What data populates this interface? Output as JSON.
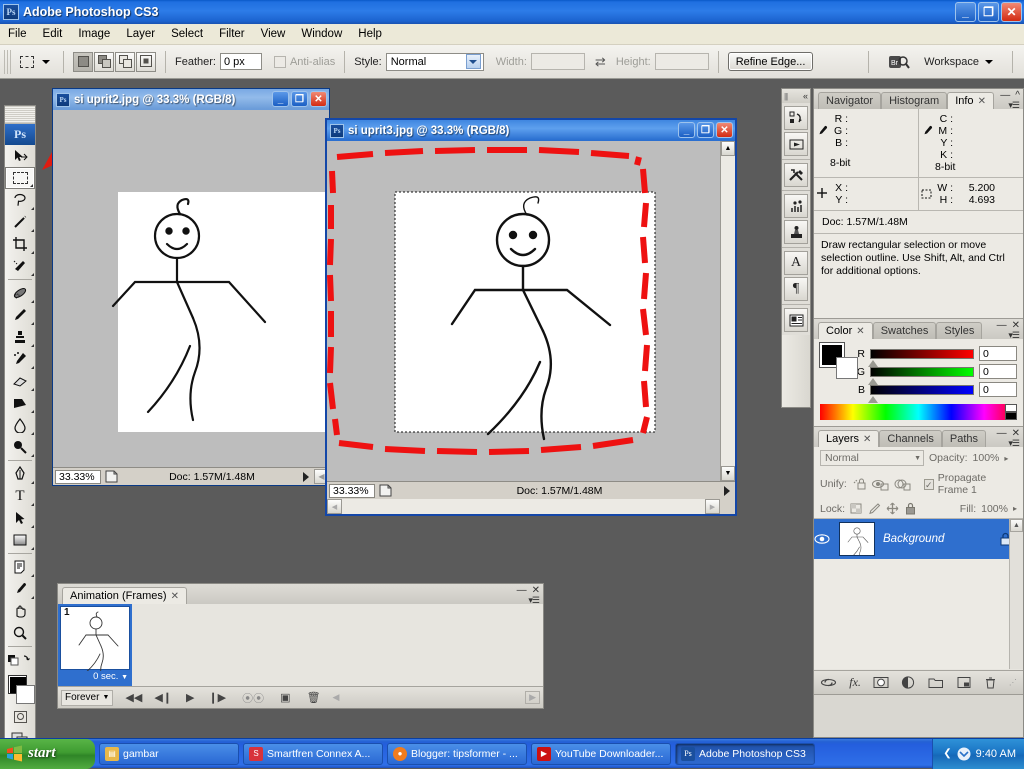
{
  "app": {
    "title": "Adobe Photoshop CS3",
    "icon": "photoshop-icon",
    "min_label": "_",
    "max_label": "□",
    "close_label": "✕"
  },
  "menubar": {
    "items": [
      "File",
      "Edit",
      "Image",
      "Layer",
      "Select",
      "Filter",
      "View",
      "Window",
      "Help"
    ]
  },
  "options_bar": {
    "tool_icon": "rectangular-marquee-icon",
    "feather_label": "Feather:",
    "feather_value": "0 px",
    "antialias_label": "Anti-alias",
    "style_label": "Style:",
    "style_value": "Normal",
    "width_label": "Width:",
    "width_value": "",
    "height_label": "Height:",
    "height_value": "",
    "swap_icon": "swap-dimensions-icon",
    "refine_edge_label": "Refine Edge...",
    "bridge_icon": "go-to-bridge-icon",
    "workspace_label": "Workspace"
  },
  "toolbox": {
    "tools": [
      {
        "name": "move-tool",
        "glyph": "↖",
        "selected": false
      },
      {
        "name": "rectangular-marquee-tool",
        "glyph": "⬚",
        "selected": true
      },
      {
        "name": "lasso-tool",
        "glyph": "☂",
        "selected": false
      },
      {
        "name": "magic-wand-tool",
        "glyph": "✦",
        "selected": false
      },
      {
        "name": "crop-tool",
        "glyph": "⛶",
        "selected": false
      },
      {
        "name": "slice-tool",
        "glyph": "✂",
        "selected": false
      },
      {
        "name": "healing-brush-tool",
        "glyph": "✎",
        "selected": false
      },
      {
        "name": "brush-tool",
        "glyph": "✐",
        "selected": false
      },
      {
        "name": "clone-stamp-tool",
        "glyph": "⚘",
        "selected": false
      },
      {
        "name": "history-brush-tool",
        "glyph": "✒",
        "selected": false
      },
      {
        "name": "eraser-tool",
        "glyph": "▱",
        "selected": false
      },
      {
        "name": "gradient-tool",
        "glyph": "◢",
        "selected": false
      },
      {
        "name": "blur-tool",
        "glyph": "◌",
        "selected": false
      },
      {
        "name": "dodge-tool",
        "glyph": "⚲",
        "selected": false
      },
      {
        "name": "pen-tool",
        "glyph": "✑",
        "selected": false
      },
      {
        "name": "horizontal-type-tool",
        "glyph": "T",
        "selected": false
      },
      {
        "name": "path-selection-tool",
        "glyph": "➤",
        "selected": false
      },
      {
        "name": "rectangle-shape-tool",
        "glyph": "▣",
        "selected": false
      },
      {
        "name": "notes-tool",
        "glyph": "▤",
        "selected": false
      },
      {
        "name": "eyedropper-tool",
        "glyph": "⚗",
        "selected": false
      },
      {
        "name": "hand-tool",
        "glyph": "✋",
        "selected": false
      },
      {
        "name": "zoom-tool",
        "glyph": "⚲",
        "selected": false
      }
    ],
    "foreground_color": "#000000",
    "background_color": "#ffffff",
    "quickmask_icon": "quick-mask-icon",
    "screenmode_icon": "screen-mode-icon"
  },
  "documents": [
    {
      "name": "doc-window-uprit2",
      "title": "si uprit2.jpg @ 33.3% (RGB/8)",
      "zoom": "33.33%",
      "doc_info": "Doc: 1.57M/1.48M",
      "active": false
    },
    {
      "name": "doc-window-uprit3",
      "title": "si uprit3.jpg @ 33.3% (RGB/8)",
      "zoom": "33.33%",
      "doc_info": "Doc: 1.57M/1.48M",
      "active": true
    }
  ],
  "animation_panel": {
    "tab_label": "Animation (Frames)",
    "frames": [
      {
        "number": "1",
        "delay": "0 sec."
      }
    ],
    "loop_label": "Forever",
    "buttons": [
      "select-first-frame",
      "select-previous-frame",
      "play-animation",
      "select-next-frame",
      "tween-frames",
      "duplicate-frame",
      "delete-frame"
    ]
  },
  "icon_strip": {
    "collapse_label": "«",
    "icons": [
      "history-actions-icon",
      "animation-icon",
      "tool-presets-icon",
      "brushes-icon",
      "clone-source-icon",
      "character-icon",
      "paragraph-icon",
      "layer-comps-icon"
    ]
  },
  "info_panel": {
    "tabs": [
      "Navigator",
      "Histogram",
      "Info"
    ],
    "active_tab": "Info",
    "left": {
      "labels": [
        "R :",
        "G :",
        "B :"
      ],
      "values": [
        "",
        "",
        ""
      ],
      "bits": "8-bit"
    },
    "right": {
      "labels": [
        "C :",
        "M :",
        "Y :",
        "K :"
      ],
      "values": [
        "",
        "",
        "",
        ""
      ],
      "bits": "8-bit"
    },
    "pos_labels": [
      "X :",
      "Y :"
    ],
    "pos_values": [
      "",
      ""
    ],
    "size_labels": [
      "W :",
      "H :"
    ],
    "size_values": [
      "5.200",
      "4.693"
    ],
    "doc_line": "Doc: 1.57M/1.48M",
    "hint": "Draw rectangular selection or move selection outline.  Use Shift, Alt, and Ctrl for additional options."
  },
  "color_panel": {
    "tabs": [
      "Color",
      "Swatches",
      "Styles"
    ],
    "active_tab": "Color",
    "channels": [
      {
        "label": "R",
        "value": "0",
        "from": "#000000",
        "to": "#ff0000"
      },
      {
        "label": "G",
        "value": "0",
        "from": "#000000",
        "to": "#00ff00"
      },
      {
        "label": "B",
        "value": "0",
        "from": "#000000",
        "to": "#0000ff"
      }
    ],
    "foreground": "#000000",
    "background": "#ffffff"
  },
  "layers_panel": {
    "tabs": [
      "Layers",
      "Channels",
      "Paths"
    ],
    "active_tab": "Layers",
    "blend_mode": "Normal",
    "opacity_label": "Opacity:",
    "opacity_value": "100%",
    "unify_label": "Unify:",
    "propagate_label": "Propagate Frame 1",
    "lock_label": "Lock:",
    "fill_label": "Fill:",
    "fill_value": "100%",
    "layers": [
      {
        "name": "Background",
        "visible": true,
        "locked": true,
        "selected": true
      }
    ],
    "bottom_buttons": [
      "link-layers-icon",
      "layer-style-icon",
      "layer-mask-icon",
      "adjustment-layer-icon",
      "new-group-icon",
      "new-layer-icon",
      "delete-layer-icon"
    ]
  },
  "taskbar": {
    "start_label": "start",
    "items": [
      {
        "label": "gambar",
        "icon_color": "#e8b84a",
        "active": false
      },
      {
        "label": "Smartfren Connex A...",
        "icon_color": "#d8333b",
        "active": false
      },
      {
        "label": "Blogger: tipsformer - ...",
        "icon_color": "#f07c1e",
        "active": false
      },
      {
        "label": "YouTube Downloader...",
        "icon_color": "#cc1111",
        "active": false
      },
      {
        "label": "Adobe Photoshop CS3",
        "icon_color": "#1a4f9e",
        "active": true
      }
    ],
    "clock": "9:40 AM",
    "tray_icons": [
      "show-hidden-icons",
      "messenger-icon"
    ]
  },
  "annotation": {
    "arrow": "red-arrow-pointing-to-marquee-tool",
    "arrow_color": "#e01b10",
    "selection_color": "#ee1111"
  }
}
